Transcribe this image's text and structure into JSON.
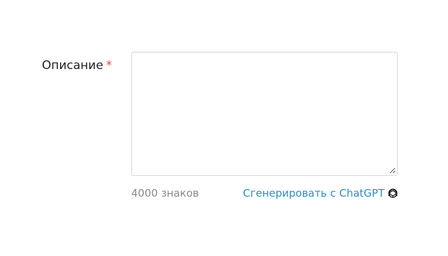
{
  "form": {
    "description": {
      "label": "Описание",
      "required_mark": "*",
      "value": "",
      "placeholder": ""
    },
    "char_counter": "4000 знаков",
    "generate_link": {
      "label": "Сгенерировать с ChatGPT",
      "icon": "chatgpt-icon"
    }
  },
  "colors": {
    "label": "#222222",
    "required": "#e0433e",
    "counter": "#8a8a8a",
    "link": "#2a8fc4",
    "border": "#d7dadd"
  }
}
